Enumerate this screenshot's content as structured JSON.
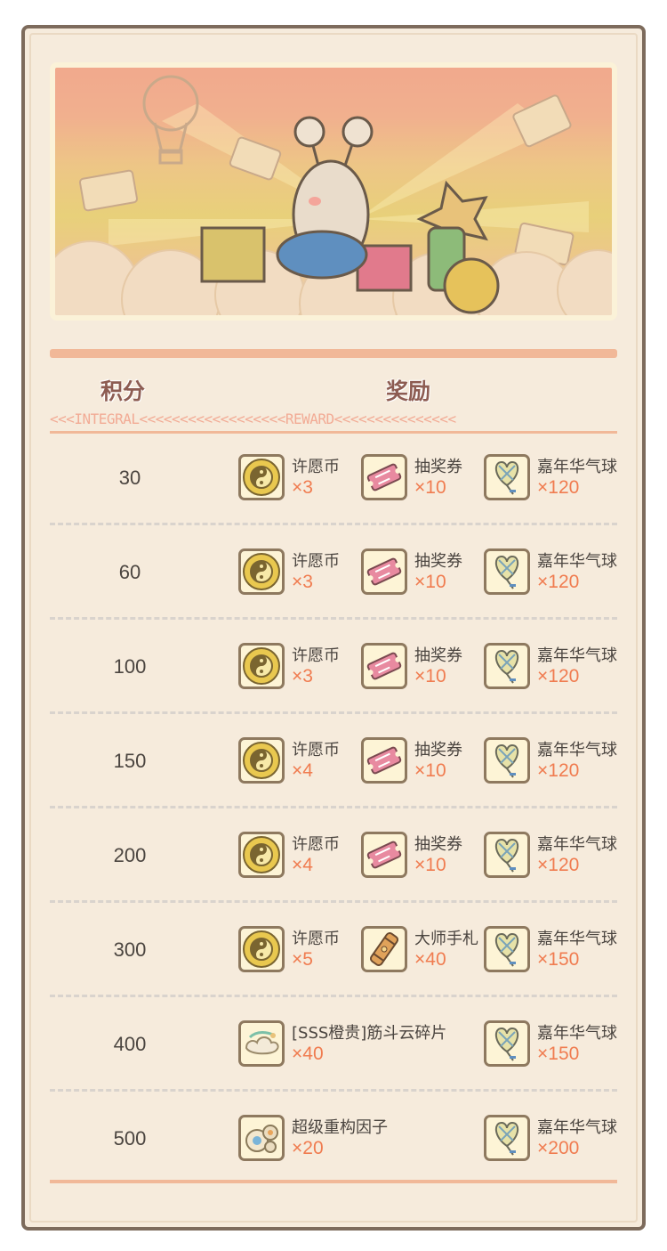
{
  "headers": {
    "score": "积分",
    "reward": "奖励"
  },
  "ticker": "<<<INTEGRAL<<<<<<<<<<<<<<<<<<REWARD<<<<<<<<<<<<<<<",
  "rows": [
    {
      "score": "30",
      "rewards": [
        {
          "icon": "wish-coin-icon",
          "name": "许愿币",
          "count": "×3"
        },
        {
          "icon": "lottery-ticket-icon",
          "name": "抽奖券",
          "count": "×10"
        },
        {
          "icon": "carnival-balloon-icon",
          "name": "嘉年华气球",
          "count": "×120"
        }
      ]
    },
    {
      "score": "60",
      "rewards": [
        {
          "icon": "wish-coin-icon",
          "name": "许愿币",
          "count": "×3"
        },
        {
          "icon": "lottery-ticket-icon",
          "name": "抽奖券",
          "count": "×10"
        },
        {
          "icon": "carnival-balloon-icon",
          "name": "嘉年华气球",
          "count": "×120"
        }
      ]
    },
    {
      "score": "100",
      "rewards": [
        {
          "icon": "wish-coin-icon",
          "name": "许愿币",
          "count": "×3"
        },
        {
          "icon": "lottery-ticket-icon",
          "name": "抽奖券",
          "count": "×10"
        },
        {
          "icon": "carnival-balloon-icon",
          "name": "嘉年华气球",
          "count": "×120"
        }
      ]
    },
    {
      "score": "150",
      "rewards": [
        {
          "icon": "wish-coin-icon",
          "name": "许愿币",
          "count": "×4"
        },
        {
          "icon": "lottery-ticket-icon",
          "name": "抽奖券",
          "count": "×10"
        },
        {
          "icon": "carnival-balloon-icon",
          "name": "嘉年华气球",
          "count": "×120"
        }
      ]
    },
    {
      "score": "200",
      "rewards": [
        {
          "icon": "wish-coin-icon",
          "name": "许愿币",
          "count": "×4"
        },
        {
          "icon": "lottery-ticket-icon",
          "name": "抽奖券",
          "count": "×10"
        },
        {
          "icon": "carnival-balloon-icon",
          "name": "嘉年华气球",
          "count": "×120"
        }
      ]
    },
    {
      "score": "300",
      "rewards": [
        {
          "icon": "wish-coin-icon",
          "name": "许愿币",
          "count": "×5"
        },
        {
          "icon": "master-notes-icon",
          "name": "大师手札",
          "count": "×40"
        },
        {
          "icon": "carnival-balloon-icon",
          "name": "嘉年华气球",
          "count": "×150"
        }
      ]
    },
    {
      "score": "400",
      "rewards": [
        {
          "icon": "cloud-fragment-icon",
          "name": "[SSS橙贵]筋斗云碎片",
          "count": "×40"
        },
        {
          "icon": "carnival-balloon-icon",
          "name": "嘉年华气球",
          "count": "×150"
        }
      ]
    },
    {
      "score": "500",
      "rewards": [
        {
          "icon": "restructure-factor-icon",
          "name": "超级重构因子",
          "count": "×20"
        },
        {
          "icon": "carnival-balloon-icon",
          "name": "嘉年华气球",
          "count": "×200"
        }
      ]
    }
  ],
  "colors": {
    "frame": "#7d6b5c",
    "panel": "#f6ebdc",
    "accent": "#f1b898",
    "count": "#f07c50",
    "header": "#8d5c52"
  }
}
